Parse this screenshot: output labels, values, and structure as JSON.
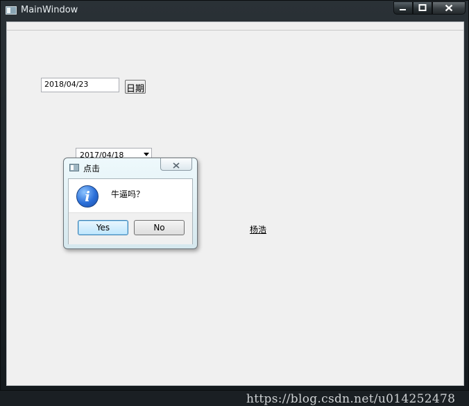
{
  "window": {
    "title": "MainWindow",
    "icons": {
      "app": "window-icon",
      "minimize": "minimize-icon",
      "maximize": "maximize-icon",
      "close": "close-icon"
    }
  },
  "main": {
    "date_edit_value": "2018/04/23",
    "date_button_label": "日期",
    "combo_value": "2017/04/18",
    "link_label": "杨浩"
  },
  "dialog": {
    "title": "点击",
    "message": "牛逼吗？",
    "icon": "information-icon",
    "yes_label": "Yes",
    "no_label": "No"
  },
  "watermark": "https://blog.csdn.net/u014252478",
  "colors": {
    "accent": "#3c7fb1",
    "info_icon": "#2b6fd8",
    "client_bg": "#f0f0f0"
  }
}
